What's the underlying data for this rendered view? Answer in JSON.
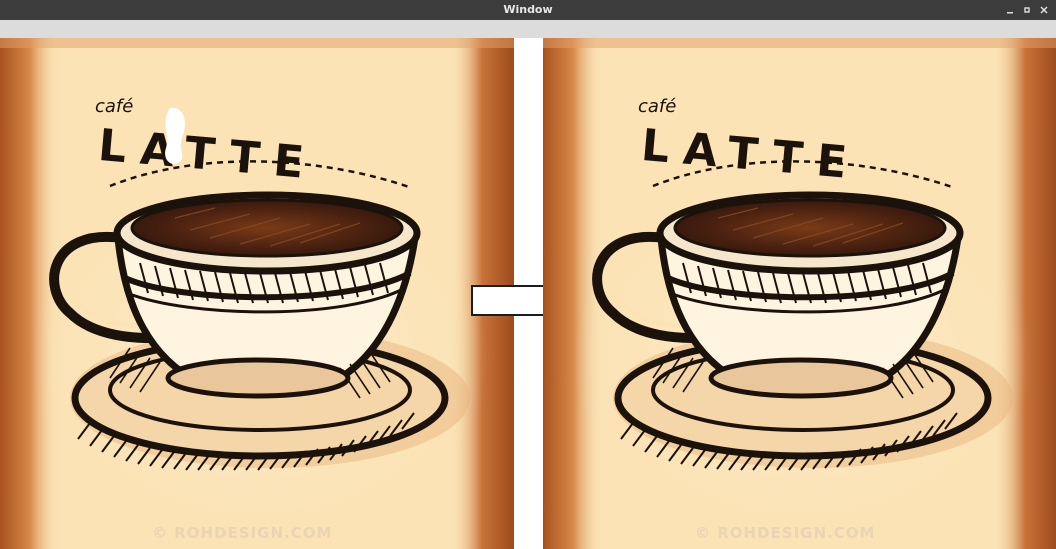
{
  "window": {
    "title": "Window",
    "controls": [
      "minimize-icon",
      "maximize-icon",
      "close-icon"
    ]
  },
  "images": {
    "left": {
      "label_small": "café",
      "label_big": "LATTE",
      "watermark": "© ROHDESIGN.COM"
    },
    "right": {
      "label_small": "café",
      "label_big": "LATTE",
      "watermark": "© ROHDESIGN.COM"
    }
  },
  "colors": {
    "titlebar": "#3c3c3c",
    "toolbar": "#dcdcdc",
    "paper": "#fbe3b6",
    "edge": "#b8622a",
    "ink": "#1c120c",
    "coffee": "#5b2c14"
  }
}
